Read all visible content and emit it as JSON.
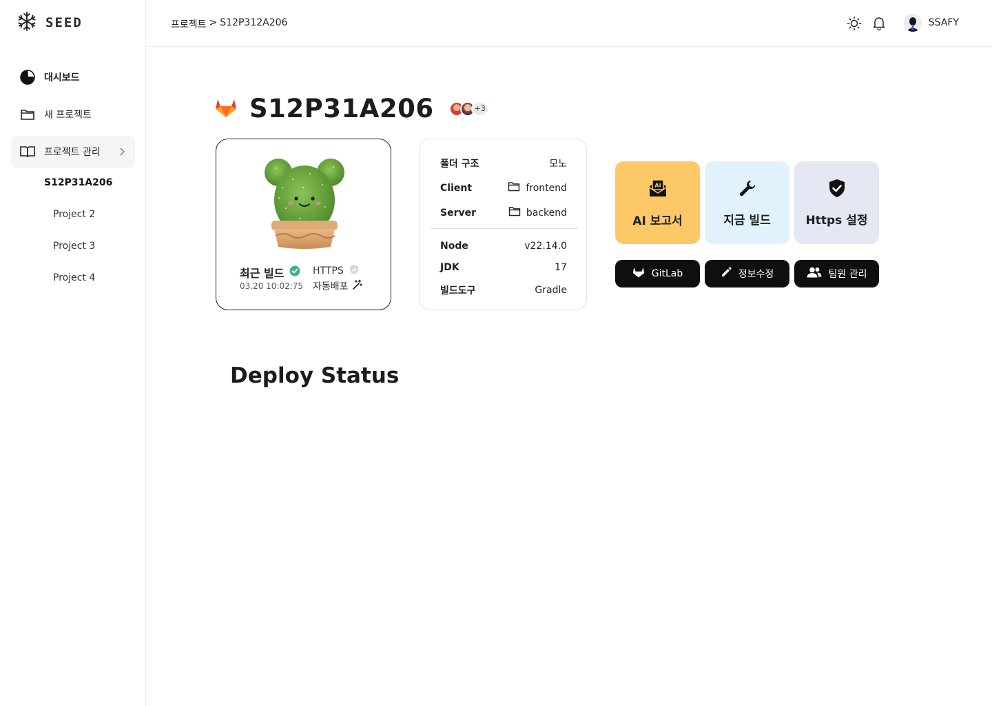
{
  "app": {
    "logo_text": "SEED",
    "brand_colors": {
      "accent_yellow": "#fdc866",
      "light_blue": "#e2f2fc",
      "light_gray_blue": "#e3e8f2",
      "success_green": "#3fb37f",
      "gitlab_orange": "#fc6d26"
    }
  },
  "sidebar": {
    "items": [
      {
        "label": "대시보드",
        "icon": "pie-chart-icon"
      },
      {
        "label": "새 프로젝트",
        "icon": "folder-icon"
      },
      {
        "label": "프로젝트 관리",
        "icon": "book-icon"
      }
    ],
    "projects": [
      {
        "label": "S12P31A206",
        "current": true
      },
      {
        "label": "Project 2"
      },
      {
        "label": "Project 3"
      },
      {
        "label": "Project 4"
      }
    ]
  },
  "header": {
    "breadcrumb": {
      "parent": "프로젝트",
      "separator": ">",
      "current": "S12P312A206"
    },
    "user_name": "SSAFY"
  },
  "project": {
    "title": "S12P31A206",
    "members_more": "+3"
  },
  "build_card": {
    "recent_build_label": "최근 빌드",
    "recent_build_time": "03.20 10:02:75",
    "https_label": "HTTPS",
    "auto_deploy_label": "자동배포"
  },
  "info_card": {
    "folder_structure_key": "폴더 구조",
    "folder_structure_value": "모노",
    "client_key": "Client",
    "client_value": "frontend",
    "server_key": "Server",
    "server_value": "backend",
    "node_key": "Node",
    "node_value": "v22.14.0",
    "jdk_key": "JDK",
    "jdk_value": "17",
    "build_tool_key": "빌드도구",
    "build_tool_value": "Gradle"
  },
  "actions": {
    "ai_report": "AI 보고서",
    "build_now": "지금 빌드",
    "https_settings": "Https 설정",
    "gitlab": "GitLab",
    "edit_info": "정보수정",
    "team_manage": "팀원 관리"
  },
  "section": {
    "deploy_status": "Deploy Status"
  }
}
